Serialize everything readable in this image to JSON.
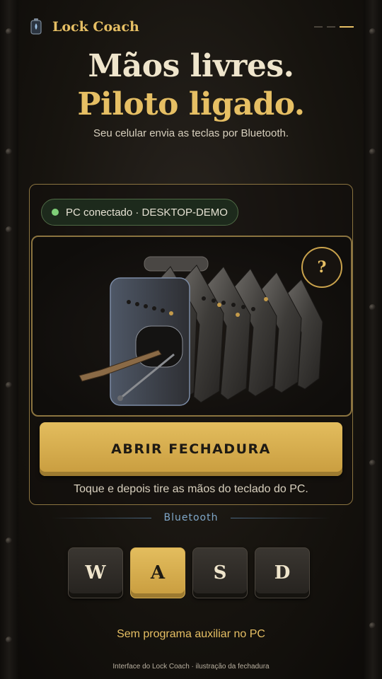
{
  "header": {
    "brand": "Lock Coach",
    "logo_icon": "lantern-icon",
    "pager": {
      "total": 3,
      "active": 2
    }
  },
  "hero": {
    "line1": "Mãos livres.",
    "line2": "Piloto ligado.",
    "subtitle": "Seu celular envia as teclas por Bluetooth."
  },
  "card": {
    "status": {
      "text": "PC conectado · DESKTOP-DEMO",
      "color": "#7fcf78"
    },
    "illustration": {
      "icon": "multi-lever-lock-illustration",
      "help_label": "?"
    },
    "primary_label": "ABRIR FECHADURA",
    "hint": "Toque e depois tire as mãos do teclado do PC."
  },
  "bluetooth": {
    "label": "Bluetooth",
    "keys": [
      {
        "label": "W",
        "active": false
      },
      {
        "label": "A",
        "active": true
      },
      {
        "label": "S",
        "active": false
      },
      {
        "label": "D",
        "active": false
      }
    ]
  },
  "footer": {
    "note": "Sem programa auxiliar no PC",
    "caption": "Interface do Lock Coach · ilustração da fechadura"
  },
  "colors": {
    "accent": "#e6bf64",
    "background": "#17140f",
    "status_green": "#7fcf78",
    "bluetooth_blue": "#7fa7c9"
  }
}
